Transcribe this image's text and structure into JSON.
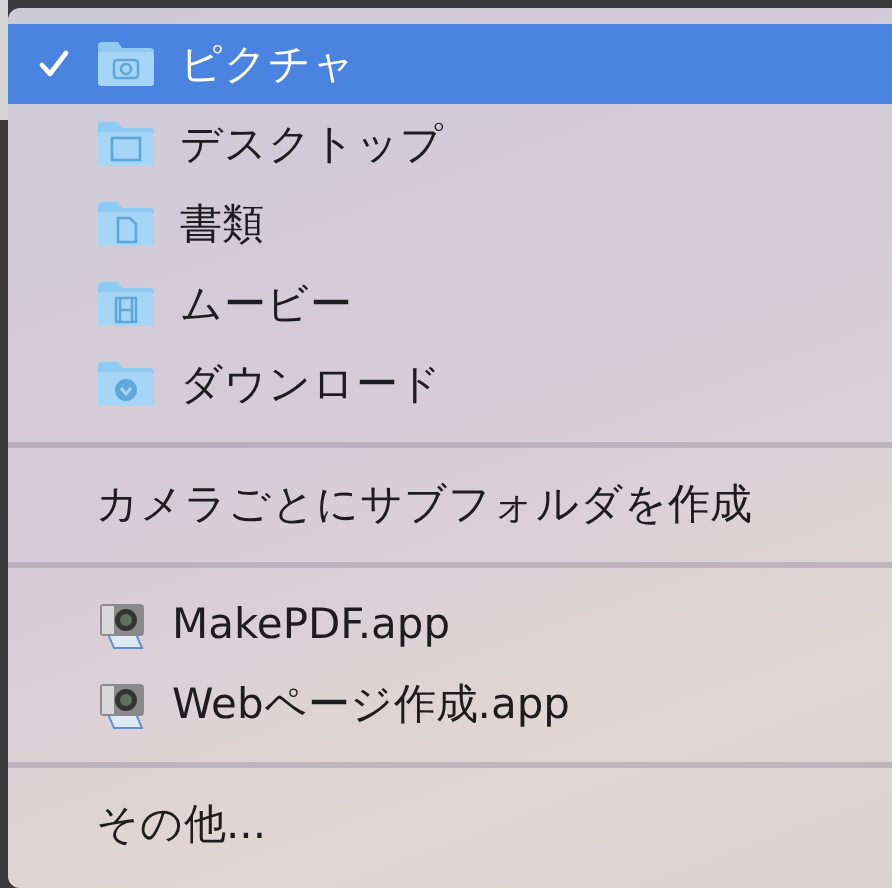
{
  "menu": {
    "sections": [
      {
        "items": [
          {
            "kind": "folder",
            "label": "ピクチャ",
            "selected": true
          },
          {
            "kind": "folder",
            "label": "デスクトップ",
            "selected": false
          },
          {
            "kind": "folder",
            "label": "書類",
            "selected": false
          },
          {
            "kind": "folder",
            "label": "ムービー",
            "selected": false
          },
          {
            "kind": "folder",
            "label": "ダウンロード",
            "selected": false
          }
        ]
      },
      {
        "items": [
          {
            "kind": "action",
            "label": "カメラごとにサブフォルダを作成"
          }
        ]
      },
      {
        "items": [
          {
            "kind": "app",
            "label": "MakePDF.app"
          },
          {
            "kind": "app",
            "label": "Webページ作成.app"
          }
        ]
      },
      {
        "items": [
          {
            "kind": "action",
            "label": "その他..."
          }
        ]
      }
    ]
  }
}
